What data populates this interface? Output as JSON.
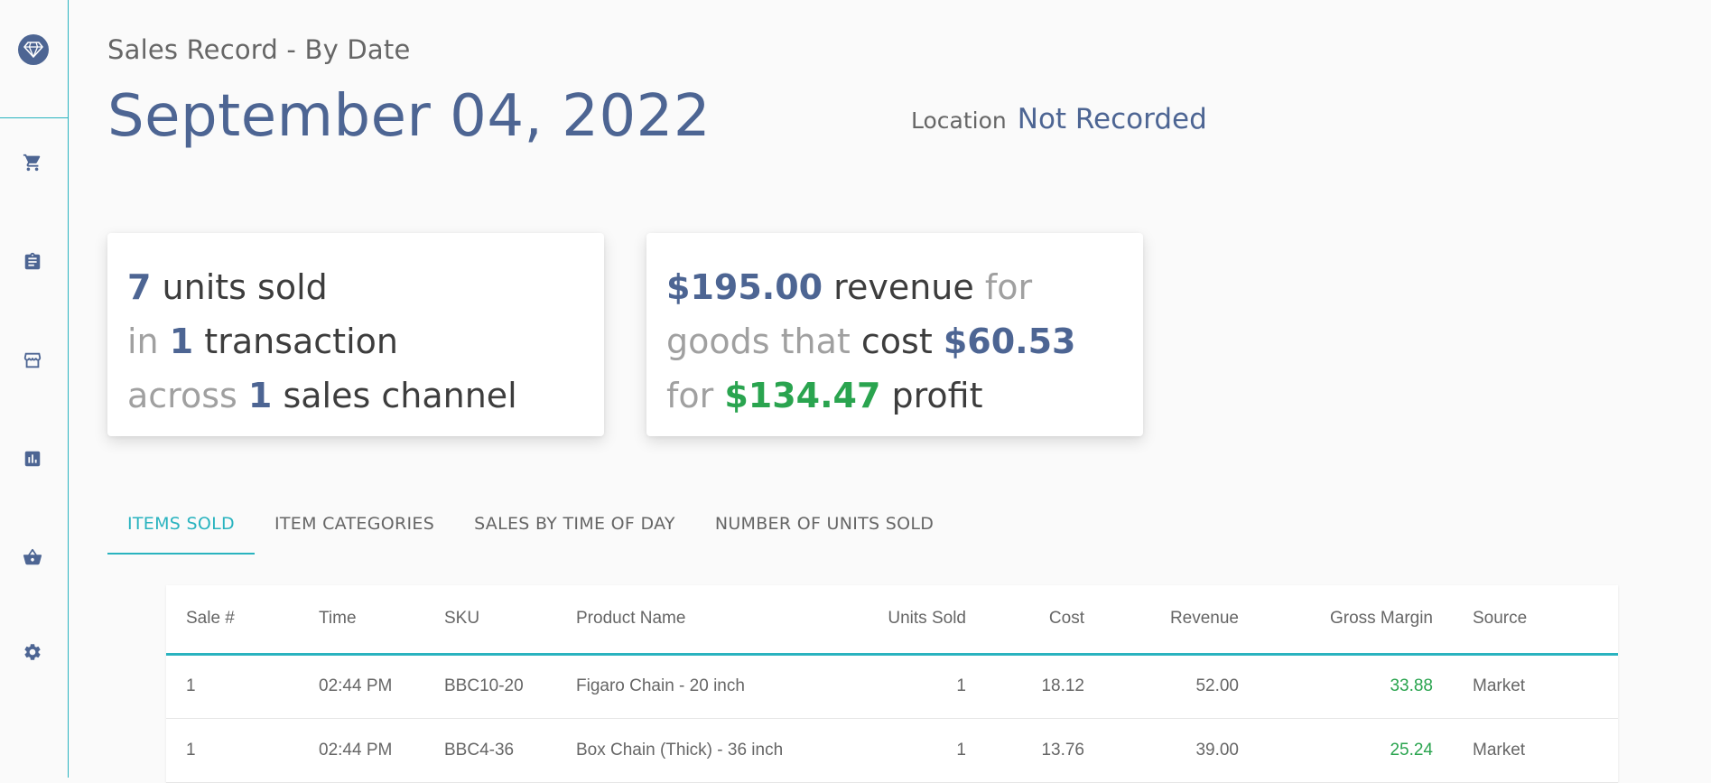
{
  "nav": {
    "icons": [
      "diamond-icon",
      "cart-icon",
      "clipboard-icon",
      "store-icon",
      "chart-icon",
      "basket-icon",
      "gear-icon"
    ]
  },
  "header": {
    "subtitle": "Sales Record - By Date",
    "date": "September 04, 2022",
    "location_label": "Location",
    "location_value": "Not Recorded"
  },
  "summary_units": {
    "units": "7",
    "units_label": "units sold",
    "in": "in",
    "transactions": "1",
    "transactions_label": "transaction",
    "across": "across",
    "channels": "1",
    "channels_label": "sales channel"
  },
  "summary_money": {
    "revenue": "$195.00",
    "revenue_label": "revenue",
    "for1": "for",
    "goods_that": "goods that",
    "cost_label": "cost",
    "cost": "$60.53",
    "for2": "for",
    "profit": "$134.47",
    "profit_label": "profit"
  },
  "tabs": [
    {
      "label": "ITEMS SOLD",
      "active": true
    },
    {
      "label": "ITEM CATEGORIES",
      "active": false
    },
    {
      "label": "SALES BY TIME OF DAY",
      "active": false
    },
    {
      "label": "NUMBER OF UNITS SOLD",
      "active": false
    }
  ],
  "table": {
    "columns": [
      "Sale #",
      "Time",
      "SKU",
      "Product Name",
      "Units Sold",
      "Cost",
      "Revenue",
      "Gross Margin",
      "Source"
    ],
    "rows": [
      [
        "1",
        "02:44 PM",
        "BBC10-20",
        "Figaro Chain - 20 inch",
        "1",
        "18.12",
        "52.00",
        "33.88",
        "Market"
      ],
      [
        "1",
        "02:44 PM",
        "BBC4-36",
        "Box Chain (Thick) - 36 inch",
        "1",
        "13.76",
        "39.00",
        "25.24",
        "Market"
      ]
    ]
  },
  "colors": {
    "accent": "#29b3bf",
    "primary": "#4d6593",
    "profit": "#2aa44f"
  }
}
